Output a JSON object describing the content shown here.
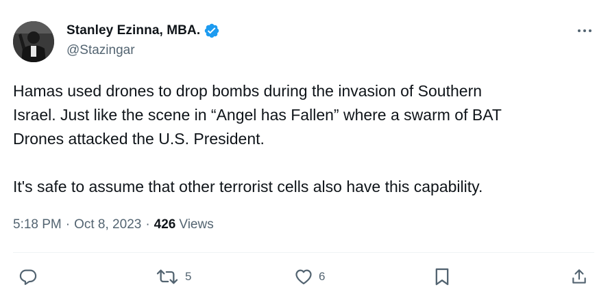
{
  "author": {
    "name": "Stanley Ezinna, MBA.",
    "handle": "@Stazingar",
    "verified": true
  },
  "tweet": {
    "paragraph1": "Hamas used drones to drop bombs during the invasion of Southern\nIsrael. Just like the scene in “Angel has Fallen” where a swarm of BAT\nDrones attacked the U.S. President.",
    "paragraph2": "It's safe to assume that other terrorist cells also have this capability."
  },
  "meta": {
    "time": "5:18 PM",
    "separator": "·",
    "date": "Oct 8, 2023",
    "views_count": "426",
    "views_label": "Views"
  },
  "actions": {
    "reply_count": "",
    "retweet_count": "5",
    "like_count": "6"
  },
  "icons": {
    "verified": "verified-badge-icon",
    "more": "more-options-icon",
    "reply": "reply-icon",
    "retweet": "retweet-icon",
    "like": "like-icon",
    "bookmark": "bookmark-icon",
    "share": "share-icon"
  },
  "colors": {
    "text_primary": "#0f1419",
    "text_secondary": "#536471",
    "verified_blue": "#1d9bf0",
    "divider": "#eff3f4"
  }
}
